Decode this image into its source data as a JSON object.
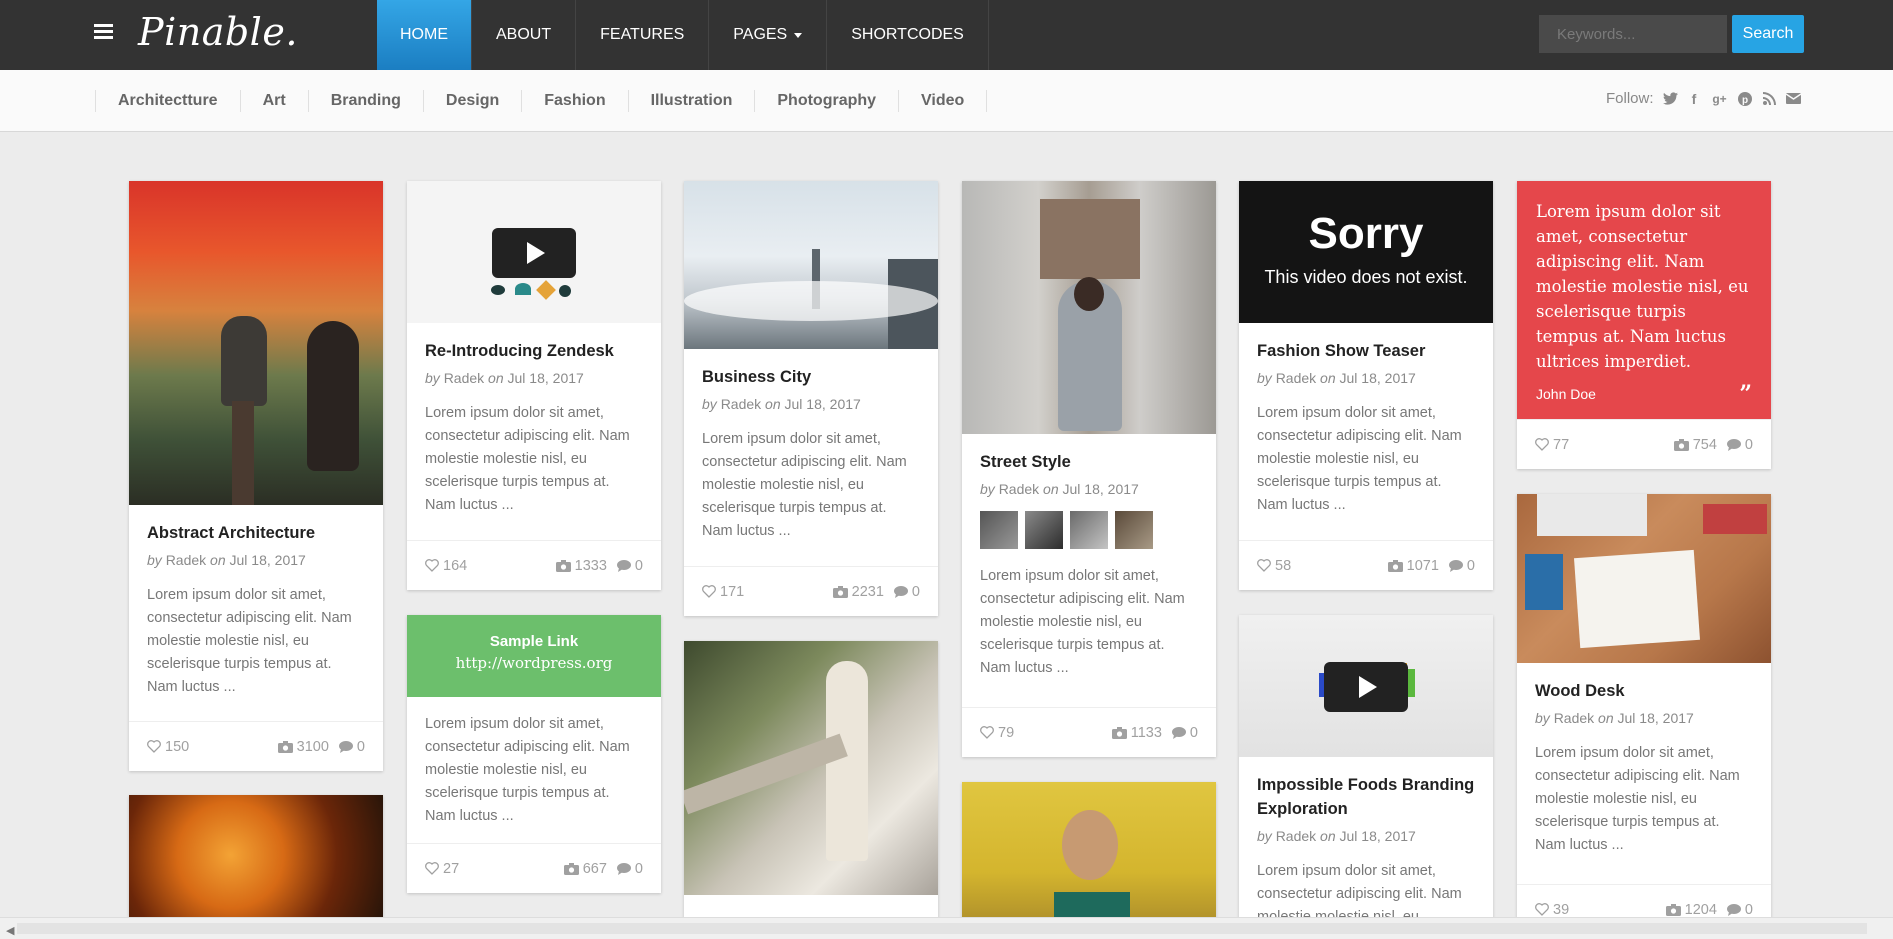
{
  "header": {
    "logo": "Pinable.",
    "nav": [
      {
        "label": "HOME",
        "active": true
      },
      {
        "label": "ABOUT"
      },
      {
        "label": "FEATURES"
      },
      {
        "label": "PAGES",
        "dropdown": true
      },
      {
        "label": "SHORTCODES"
      }
    ],
    "search": {
      "placeholder": "Keywords...",
      "button": "Search"
    },
    "accent": "#27a4e4"
  },
  "categories": [
    "Architectture",
    "Art",
    "Branding",
    "Design",
    "Fashion",
    "Illustration",
    "Photography",
    "Video"
  ],
  "follow": {
    "label": "Follow:",
    "icons": [
      "twitter-icon",
      "facebook-icon",
      "google-plus-icon",
      "pinterest-icon",
      "rss-icon",
      "email-icon"
    ]
  },
  "byline": {
    "by": "by",
    "author": "Radek",
    "on": "on",
    "date": "Jul 18, 2017"
  },
  "excerpt": "Lorem ipsum dolor sit amet, consectetur adipiscing elit. Nam molestie molestie nisl, eu scelerisque turpis tempus at. Nam luctus ...",
  "cards": {
    "abstract": {
      "title": "Abstract Architecture",
      "likes": "150",
      "photos": "3100",
      "comments": "0"
    },
    "zendesk": {
      "title": "Re-Introducing Zendesk",
      "likes": "164",
      "photos": "1333",
      "comments": "0"
    },
    "link": {
      "title": "Sample Link",
      "url": "http://wordpress.org",
      "likes": "27",
      "photos": "667",
      "comments": "0",
      "color": "#6cbf6c"
    },
    "business": {
      "title": "Business City",
      "likes": "171",
      "photos": "2231",
      "comments": "0"
    },
    "street": {
      "title": "Street Style",
      "likes": "79",
      "photos": "1133",
      "comments": "0"
    },
    "fashion": {
      "title": "Fashion Show Teaser",
      "video_error_title": "Sorry",
      "video_error_text": "This video does not exist.",
      "likes": "58",
      "photos": "1071",
      "comments": "0"
    },
    "impossible": {
      "title": "Impossible Foods Branding Exploration"
    },
    "quote": {
      "text": "Lorem ipsum dolor sit amet, consectetur adipiscing elit. Nam molestie molestie nisl, eu scelerisque turpis tempus at. Nam luctus ultrices imperdiet.",
      "author": "John Doe",
      "likes": "77",
      "photos": "754",
      "comments": "0",
      "color": "#e5474b"
    },
    "wood": {
      "title": "Wood Desk",
      "likes": "39",
      "photos": "1204",
      "comments": "0"
    }
  }
}
